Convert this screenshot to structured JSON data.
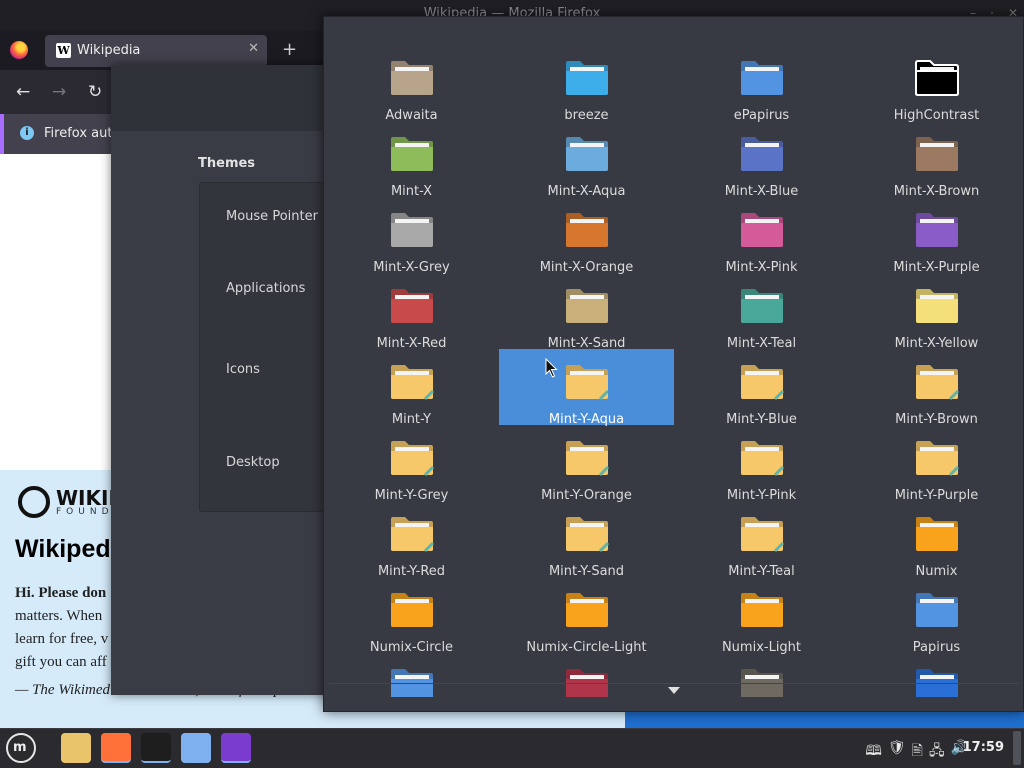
{
  "firefox": {
    "window_title": "Wikipedia — Mozilla Firefox",
    "tab_title": "Wikipedia",
    "tab_favicon": "W",
    "tab_close": "✕",
    "new_tab": "+",
    "nav": {
      "back": "←",
      "forward": "→",
      "reload": "↻"
    },
    "infobar_text": "Firefox auto",
    "info_icon": "i"
  },
  "wikipedia": {
    "logo_text": "WIKIM",
    "logo_sub": "FOUND",
    "heading": "Wikiped",
    "lines": [
      "Hi. Please don",
      "matters. When",
      "learn for free, v",
      "gift you can aff"
    ],
    "signature": "— The Wikimedia Foundation, host of Wikipedi"
  },
  "themes": {
    "title": "Themes",
    "items": [
      "Mouse Pointer",
      "Applications",
      "Icons",
      "Desktop"
    ]
  },
  "icon_chooser": {
    "selected": "Mint-Y-Aqua",
    "icons": [
      {
        "label": "Adwaita",
        "color": "#b8a48a"
      },
      {
        "label": "breeze",
        "color": "#3daee9"
      },
      {
        "label": "ePapirus",
        "color": "#5294e2"
      },
      {
        "label": "HighContrast",
        "color": "#000000"
      },
      {
        "label": "Mint-X",
        "color": "#8fbc5a"
      },
      {
        "label": "Mint-X-Aqua",
        "color": "#6cabdd"
      },
      {
        "label": "Mint-X-Blue",
        "color": "#5b73c7"
      },
      {
        "label": "Mint-X-Brown",
        "color": "#9c7a62"
      },
      {
        "label": "Mint-X-Grey",
        "color": "#a8a8a8"
      },
      {
        "label": "Mint-X-Orange",
        "color": "#d7772e"
      },
      {
        "label": "Mint-X-Pink",
        "color": "#d45a9a"
      },
      {
        "label": "Mint-X-Purple",
        "color": "#8a5cc7"
      },
      {
        "label": "Mint-X-Red",
        "color": "#c94a4a"
      },
      {
        "label": "Mint-X-Sand",
        "color": "#c9b07a"
      },
      {
        "label": "Mint-X-Teal",
        "color": "#4aa89a"
      },
      {
        "label": "Mint-X-Yellow",
        "color": "#f3e07a"
      },
      {
        "label": "Mint-Y",
        "color": "#f7c86a"
      },
      {
        "label": "Mint-Y-Aqua",
        "color": "#f7c86a"
      },
      {
        "label": "Mint-Y-Blue",
        "color": "#f7c86a"
      },
      {
        "label": "Mint-Y-Brown",
        "color": "#f7c86a"
      },
      {
        "label": "Mint-Y-Grey",
        "color": "#f7c86a"
      },
      {
        "label": "Mint-Y-Orange",
        "color": "#f7c86a"
      },
      {
        "label": "Mint-Y-Pink",
        "color": "#f7c86a"
      },
      {
        "label": "Mint-Y-Purple",
        "color": "#f7c86a"
      },
      {
        "label": "Mint-Y-Red",
        "color": "#f7c86a"
      },
      {
        "label": "Mint-Y-Sand",
        "color": "#f7c86a"
      },
      {
        "label": "Mint-Y-Teal",
        "color": "#f7c86a"
      },
      {
        "label": "Numix",
        "color": "#f9a21b"
      },
      {
        "label": "Numix-Circle",
        "color": "#f9a21b"
      },
      {
        "label": "Numix-Circle-Light",
        "color": "#f9a21b"
      },
      {
        "label": "Numix-Light",
        "color": "#f9a21b"
      },
      {
        "label": "Papirus",
        "color": "#5294e2"
      },
      {
        "label": "",
        "color": "#5294e2"
      },
      {
        "label": "",
        "color": "#b0354a"
      },
      {
        "label": "",
        "color": "#6e6a62"
      },
      {
        "label": "",
        "color": "#2a6fd6"
      }
    ]
  },
  "taskbar": {
    "menu_glyph": "m",
    "apps": [
      {
        "name": "files",
        "color": "#e9c46a"
      },
      {
        "name": "firefox",
        "color": "#ff7139"
      },
      {
        "name": "terminal",
        "color": "#1e1e1e"
      },
      {
        "name": "folder",
        "color": "#7fb0f0"
      },
      {
        "name": "paint",
        "color": "#7a3ccf"
      }
    ],
    "tray": [
      "🕮",
      "🛡",
      "🖹",
      "🖧",
      "🔊"
    ],
    "clock": "17:59"
  }
}
